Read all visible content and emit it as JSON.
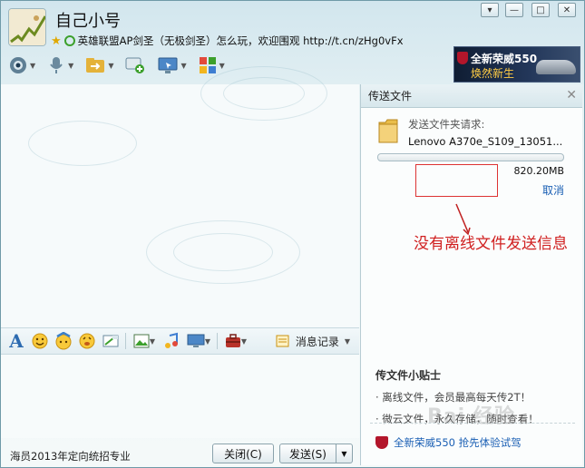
{
  "window": {
    "title": "自己小号",
    "signature": "英雄联盟AP剑圣（无极剑圣）怎么玩，欢迎围观 http://t.cn/zHg0vFx",
    "controls": [
      "▾",
      "—",
      "□",
      "✕"
    ]
  },
  "ad_banner": {
    "line1": "全新荣威550",
    "line2": "焕然新生"
  },
  "toolbar": {
    "items": [
      "camera-icon",
      "mic-icon",
      "transfer-file-icon",
      "message-add-icon",
      "remote-desktop-icon",
      "apps-icon"
    ]
  },
  "format_bar": {
    "items": [
      "font-icon",
      "emoji-icon",
      "magic-emoji-icon",
      "shake-icon",
      "screenshot-icon",
      "image-icon",
      "music-icon",
      "screen-share-icon",
      "toolbox-icon"
    ],
    "history_label": "消息记录"
  },
  "bottom": {
    "left_label": "海员2013年定向统招专业",
    "close_label": "关闭(C)",
    "send_label": "发送(S)"
  },
  "transfer_panel": {
    "header": "传送文件",
    "request_label": "发送文件夹请求:",
    "file_name": "Lenovo A370e_S109_13051...",
    "progress": 0.0,
    "file_size": "820.20MB",
    "cancel_label": "取消",
    "annotation": "没有离线文件发送信息",
    "tips_title": "传文件小贴士",
    "tips": [
      "· 离线文件，会员最高每天传2T！",
      "· 微云文件，永久存储，随时查看！"
    ],
    "ad_link": "全新荣威550 抢先体验试驾"
  },
  "watermark": "Bai 经验",
  "colors": {
    "accent": "#1a5fb4",
    "annotation": "#d02020",
    "panel_border": "#b7ccd3"
  }
}
